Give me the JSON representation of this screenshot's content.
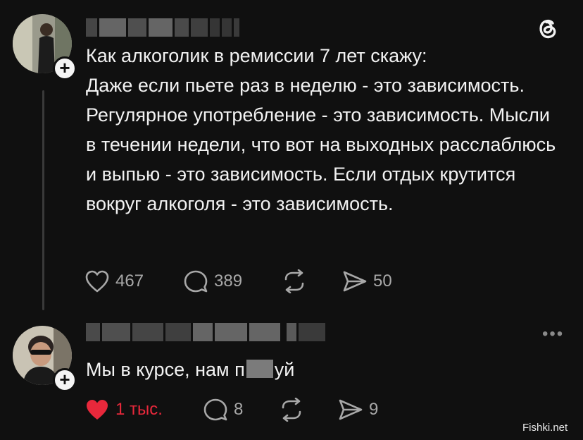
{
  "post": {
    "text": "Как алкоголик в ремиссии 7 лет скажу:\nДаже если пьете раз в неделю - это зависимость. Регулярное употребление - это зависимость. Мысли в течении недели, что вот на выходных расслаблюсь и выпью - это зависимость. Если отдых крутится вокруг алкоголя - это зависимость.",
    "likes": "467",
    "replies": "389",
    "shares": "50"
  },
  "reply": {
    "text_before": "Мы в курсе, нам п",
    "text_after": "уй",
    "likes": "1 тыс.",
    "replies": "8",
    "shares": "9",
    "more": "•••"
  },
  "badge_symbol": "+",
  "watermark": "Fishki.net",
  "colors": {
    "background": "#101010",
    "liked": "#e8283b",
    "muted": "#a8a8a8"
  }
}
